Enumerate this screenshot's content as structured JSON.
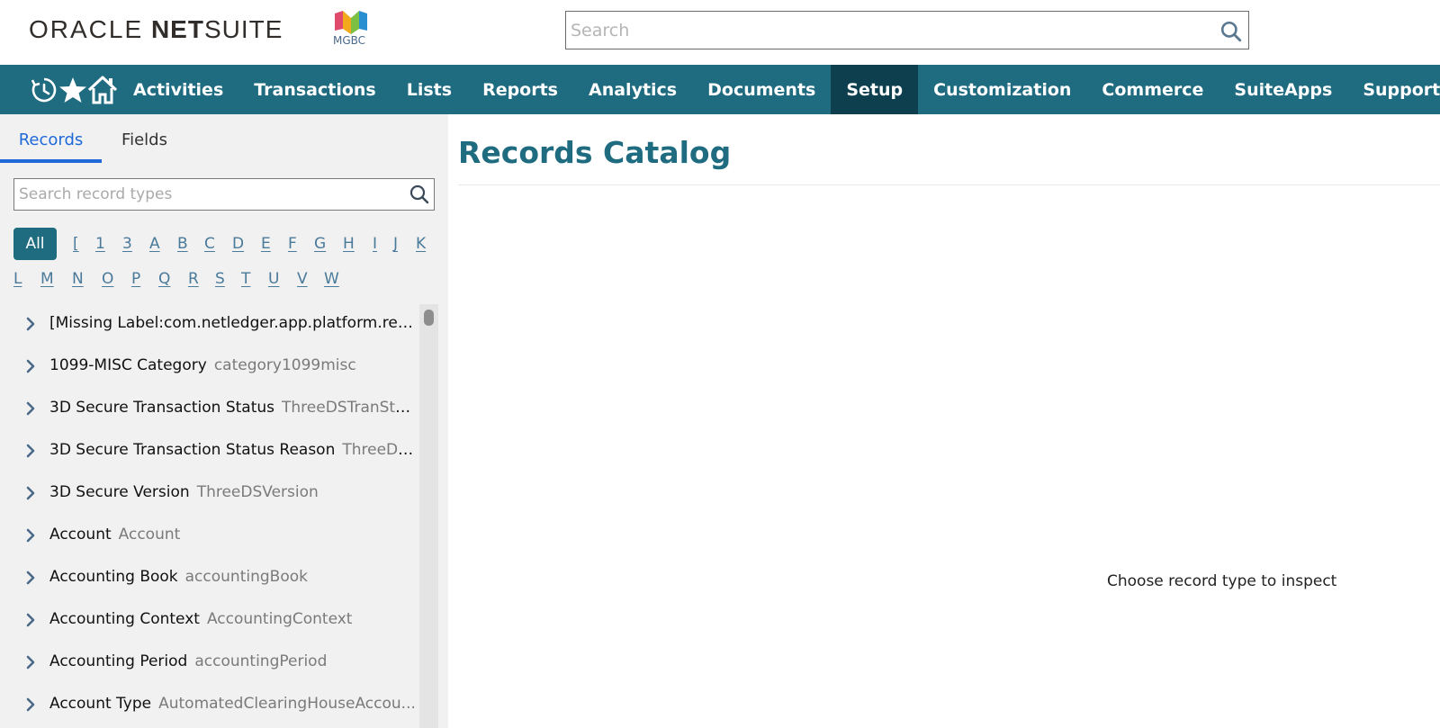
{
  "header": {
    "logo": {
      "oracle": "ORACLE",
      "net": "NET",
      "suite": "SUITE"
    },
    "brand_text": "MGBC",
    "search": {
      "placeholder": "Search",
      "value": ""
    }
  },
  "nav": {
    "items": [
      {
        "label": "Activities",
        "active": false
      },
      {
        "label": "Transactions",
        "active": false
      },
      {
        "label": "Lists",
        "active": false
      },
      {
        "label": "Reports",
        "active": false
      },
      {
        "label": "Analytics",
        "active": false
      },
      {
        "label": "Documents",
        "active": false
      },
      {
        "label": "Setup",
        "active": true
      },
      {
        "label": "Customization",
        "active": false
      },
      {
        "label": "Commerce",
        "active": false
      },
      {
        "label": "SuiteApps",
        "active": false
      },
      {
        "label": "Support",
        "active": false
      }
    ],
    "icons": [
      "recent-records-icon",
      "favorites-star-icon",
      "home-icon"
    ]
  },
  "sidebar": {
    "tabs": [
      {
        "label": "Records",
        "active": true
      },
      {
        "label": "Fields",
        "active": false
      }
    ],
    "search": {
      "placeholder": "Search record types",
      "value": ""
    },
    "all_label": "All",
    "letters": [
      "[",
      "1",
      "3",
      "A",
      "B",
      "C",
      "D",
      "E",
      "F",
      "G",
      "H",
      "I",
      "J",
      "K",
      "L",
      "M",
      "N",
      "O",
      "P",
      "Q",
      "R",
      "S",
      "T",
      "U",
      "V",
      "W"
    ],
    "records": [
      {
        "name": "[Missing Label:com.netledger.app.platform.recor",
        "id": ""
      },
      {
        "name": "1099-MISC Category",
        "id": "category1099misc"
      },
      {
        "name": "3D Secure Transaction Status",
        "id": "ThreeDSTranStat..."
      },
      {
        "name": "3D Secure Transaction Status Reason",
        "id": "ThreeDS..."
      },
      {
        "name": "3D Secure Version",
        "id": "ThreeDSVersion"
      },
      {
        "name": "Account",
        "id": "Account"
      },
      {
        "name": "Accounting Book",
        "id": "accountingBook"
      },
      {
        "name": "Accounting Context",
        "id": "AccountingContext"
      },
      {
        "name": "Accounting Period",
        "id": "accountingPeriod"
      },
      {
        "name": "Account Type",
        "id": "AutomatedClearingHouseAccou..."
      }
    ]
  },
  "main": {
    "title": "Records Catalog",
    "empty_message": "Choose record type to inspect"
  },
  "colors": {
    "nav_bg": "#1f6b80",
    "nav_active": "#0e3f4f",
    "title": "#1f6b80",
    "tab_active": "#1f6ad8"
  }
}
